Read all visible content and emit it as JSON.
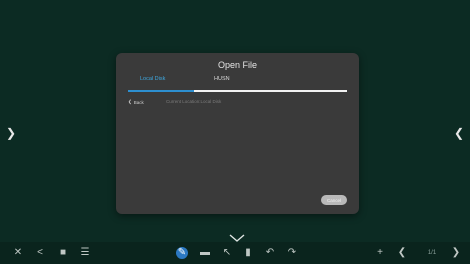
{
  "dialog": {
    "title": "Open File",
    "tabs": [
      {
        "label": "Local Disk",
        "active": true
      },
      {
        "label": "HUSN",
        "active": false
      }
    ],
    "back_label": "Back",
    "path_label": "Current Location:Local Disk",
    "cancel_label": "Cancel"
  },
  "colors": {
    "board": "#0c2b23",
    "dialog": "#3a3a3a",
    "accent": "#2d8fd0",
    "toolbar": "#0a241d"
  },
  "toolbar": {
    "left_icons": [
      "close-icon",
      "share-icon",
      "folder-icon",
      "menu-icon"
    ],
    "center_icons": [
      "pen-icon",
      "eraser-icon",
      "select-icon",
      "page-icon",
      "undo-icon",
      "redo-icon"
    ],
    "right_icons": [
      "add-page-icon",
      "prev-page-icon",
      "next-page-icon"
    ],
    "page_indicator": "1/1"
  }
}
